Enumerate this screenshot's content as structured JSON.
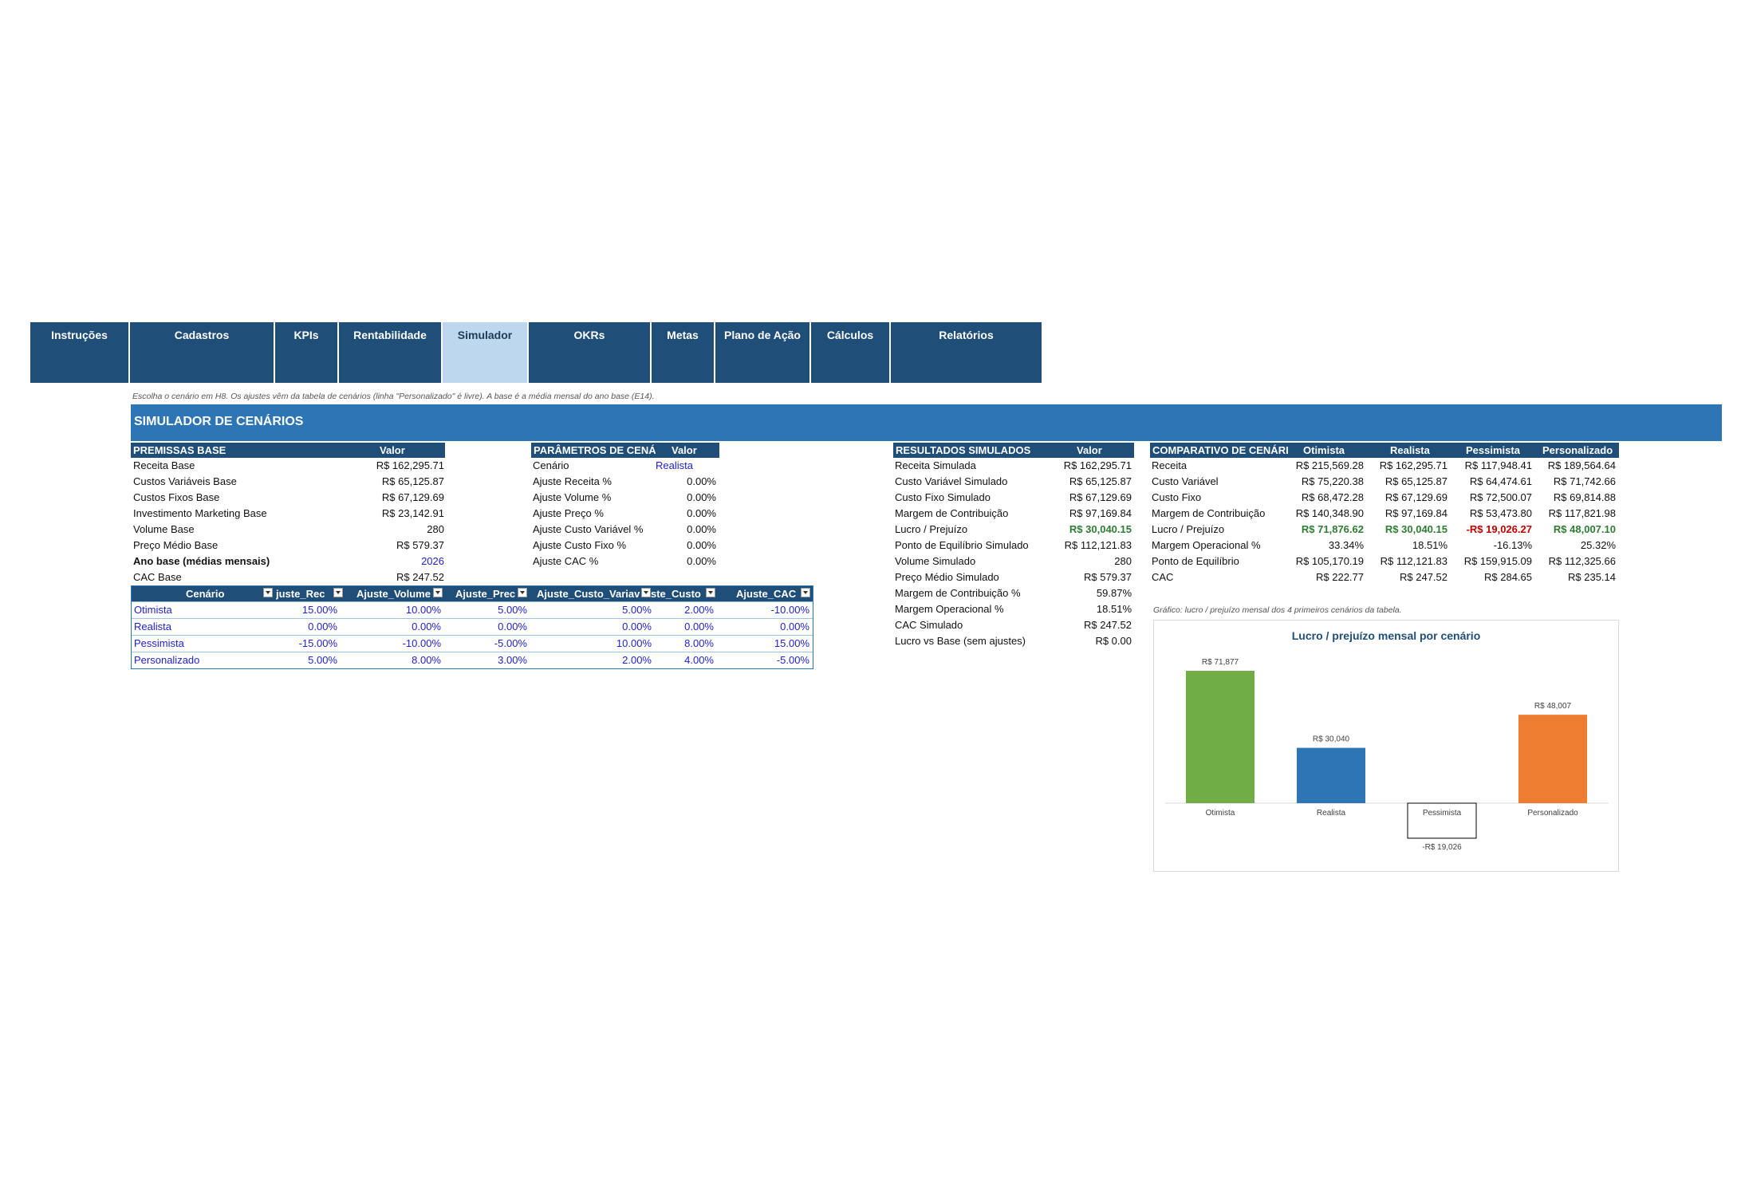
{
  "nav": {
    "tabs": [
      "Instruções",
      "Cadastros",
      "KPIs",
      "Rentabilidade",
      "Simulador",
      "OKRs",
      "Metas",
      "Plano de Ação",
      "Cálculos",
      "Relatórios"
    ],
    "active": "Simulador"
  },
  "note_top": "Escolha o cenário em H8. Os ajustes vêm da tabela de cenários (linha \"Personalizado\" é livre). A base é a média mensal do ano base (E14).",
  "title": "SIMULADOR DE CENÁRIOS",
  "premissas": {
    "header": "PREMISSAS BASE",
    "value_header": "Valor",
    "rows": [
      {
        "label": "Receita Base",
        "value": "R$ 162,295.71"
      },
      {
        "label": "Custos Variáveis Base",
        "value": "R$ 65,125.87"
      },
      {
        "label": "Custos Fixos Base",
        "value": "R$ 67,129.69"
      },
      {
        "label": "Investimento Marketing Base",
        "value": "R$ 23,142.91"
      },
      {
        "label": "Volume Base",
        "value": "280"
      },
      {
        "label": "Preço Médio Base",
        "value": "R$ 579.37"
      },
      {
        "label": "Ano base (médias mensais)",
        "value": "2026"
      },
      {
        "label": "CAC Base",
        "value": "R$ 247.52"
      }
    ]
  },
  "parametros": {
    "header": "PARÂMETROS DE CENÁF",
    "value_header": "Valor",
    "rows": [
      {
        "label": "Cenário",
        "value": "Realista"
      },
      {
        "label": "Ajuste Receita %",
        "value": "0.00%"
      },
      {
        "label": "Ajuste Volume %",
        "value": "0.00%"
      },
      {
        "label": "Ajuste Preço %",
        "value": "0.00%"
      },
      {
        "label": "Ajuste Custo Variável %",
        "value": "0.00%"
      },
      {
        "label": "Ajuste Custo Fixo %",
        "value": "0.00%"
      },
      {
        "label": "Ajuste CAC %",
        "value": "0.00%"
      }
    ]
  },
  "resultados": {
    "header": "RESULTADOS SIMULADOS",
    "value_header": "Valor",
    "rows": [
      {
        "label": "Receita Simulada",
        "value": "R$ 162,295.71"
      },
      {
        "label": "Custo Variável Simulado",
        "value": "R$ 65,125.87"
      },
      {
        "label": "Custo Fixo Simulado",
        "value": "R$ 67,129.69"
      },
      {
        "label": "Margem de Contribuição",
        "value": "R$ 97,169.84"
      },
      {
        "label": "Lucro / Prejuízo",
        "value": "R$ 30,040.15"
      },
      {
        "label": "Ponto de Equilíbrio Simulado",
        "value": "R$ 112,121.83"
      },
      {
        "label": "Volume Simulado",
        "value": "280"
      },
      {
        "label": "Preço Médio Simulado",
        "value": "R$ 579.37"
      },
      {
        "label": "Margem de Contribuição %",
        "value": "59.87%"
      },
      {
        "label": "Margem Operacional %",
        "value": "18.51%"
      },
      {
        "label": "CAC Simulado",
        "value": "R$ 247.52"
      },
      {
        "label": "Lucro vs Base (sem ajustes)",
        "value": "R$ 0.00"
      }
    ]
  },
  "comparativo": {
    "header": "COMPARATIVO DE CENÁRI",
    "columns": [
      "Otimista",
      "Realista",
      "Pessimista",
      "Personalizado"
    ],
    "rows": [
      {
        "label": "Receita",
        "values": [
          "R$ 215,569.28",
          "R$ 162,295.71",
          "R$ 117,948.41",
          "R$ 189,564.64"
        ]
      },
      {
        "label": "Custo Variável",
        "values": [
          "R$ 75,220.38",
          "R$ 65,125.87",
          "R$ 64,474.61",
          "R$ 71,742.66"
        ]
      },
      {
        "label": "Custo Fixo",
        "values": [
          "R$ 68,472.28",
          "R$ 67,129.69",
          "R$ 72,500.07",
          "R$ 69,814.88"
        ]
      },
      {
        "label": "Margem de Contribuição",
        "values": [
          "R$ 140,348.90",
          "R$ 97,169.84",
          "R$ 53,473.80",
          "R$ 117,821.98"
        ]
      },
      {
        "label": "Lucro / Prejuízo",
        "values": [
          "R$ 71,876.62",
          "R$ 30,040.15",
          "-R$ 19,026.27",
          "R$ 48,007.10"
        ]
      },
      {
        "label": "Margem Operacional %",
        "values": [
          "33.34%",
          "18.51%",
          "-16.13%",
          "25.32%"
        ]
      },
      {
        "label": "Ponto de Equilíbrio",
        "values": [
          "R$ 105,170.19",
          "R$ 112,121.83",
          "R$ 159,915.09",
          "R$ 112,325.66"
        ]
      },
      {
        "label": "CAC",
        "values": [
          "R$ 222.77",
          "R$ 247.52",
          "R$ 284.65",
          "R$ 235.14"
        ]
      }
    ]
  },
  "cenarios_table": {
    "headers": [
      "Cenário",
      "Ajuste_Rec",
      "Ajuste_Volume",
      "Ajuste_Preço",
      "Ajuste_Custo_Variável",
      "Ajuste_Custo",
      "Ajuste_CAC"
    ],
    "header_display": [
      "Cenário",
      "juste_Rec",
      "Ajuste_Volume",
      "Ajuste_Prec",
      "Ajuste_Custo_Variav",
      "ste_Custo",
      "Ajuste_CAC"
    ],
    "rows": [
      [
        "Otimista",
        "15.00%",
        "10.00%",
        "5.00%",
        "5.00%",
        "2.00%",
        "-10.00%"
      ],
      [
        "Realista",
        "0.00%",
        "0.00%",
        "0.00%",
        "0.00%",
        "0.00%",
        "0.00%"
      ],
      [
        "Pessimista",
        "-15.00%",
        "-10.00%",
        "-5.00%",
        "10.00%",
        "8.00%",
        "15.00%"
      ],
      [
        "Personalizado",
        "5.00%",
        "8.00%",
        "3.00%",
        "2.00%",
        "4.00%",
        "-5.00%"
      ]
    ]
  },
  "chart_note": "Gráfico: lucro / prejuízo mensal dos 4 primeiros cenários da tabela.",
  "chart_data": {
    "type": "bar",
    "title": "Lucro / prejuízo mensal por cenário",
    "categories": [
      "Otimista",
      "Realista",
      "Pessimista",
      "Personalizado"
    ],
    "values": [
      71877,
      30040,
      -19026,
      48007
    ],
    "labels": [
      "R$ 71,877",
      "R$ 30,040",
      "-R$ 19,026",
      "R$ 48,007"
    ],
    "colors": [
      "#70ad47",
      "#2e75b6",
      "#ffffff",
      "#ed7d31"
    ],
    "xlabel": "",
    "ylabel": "",
    "grid": false
  }
}
